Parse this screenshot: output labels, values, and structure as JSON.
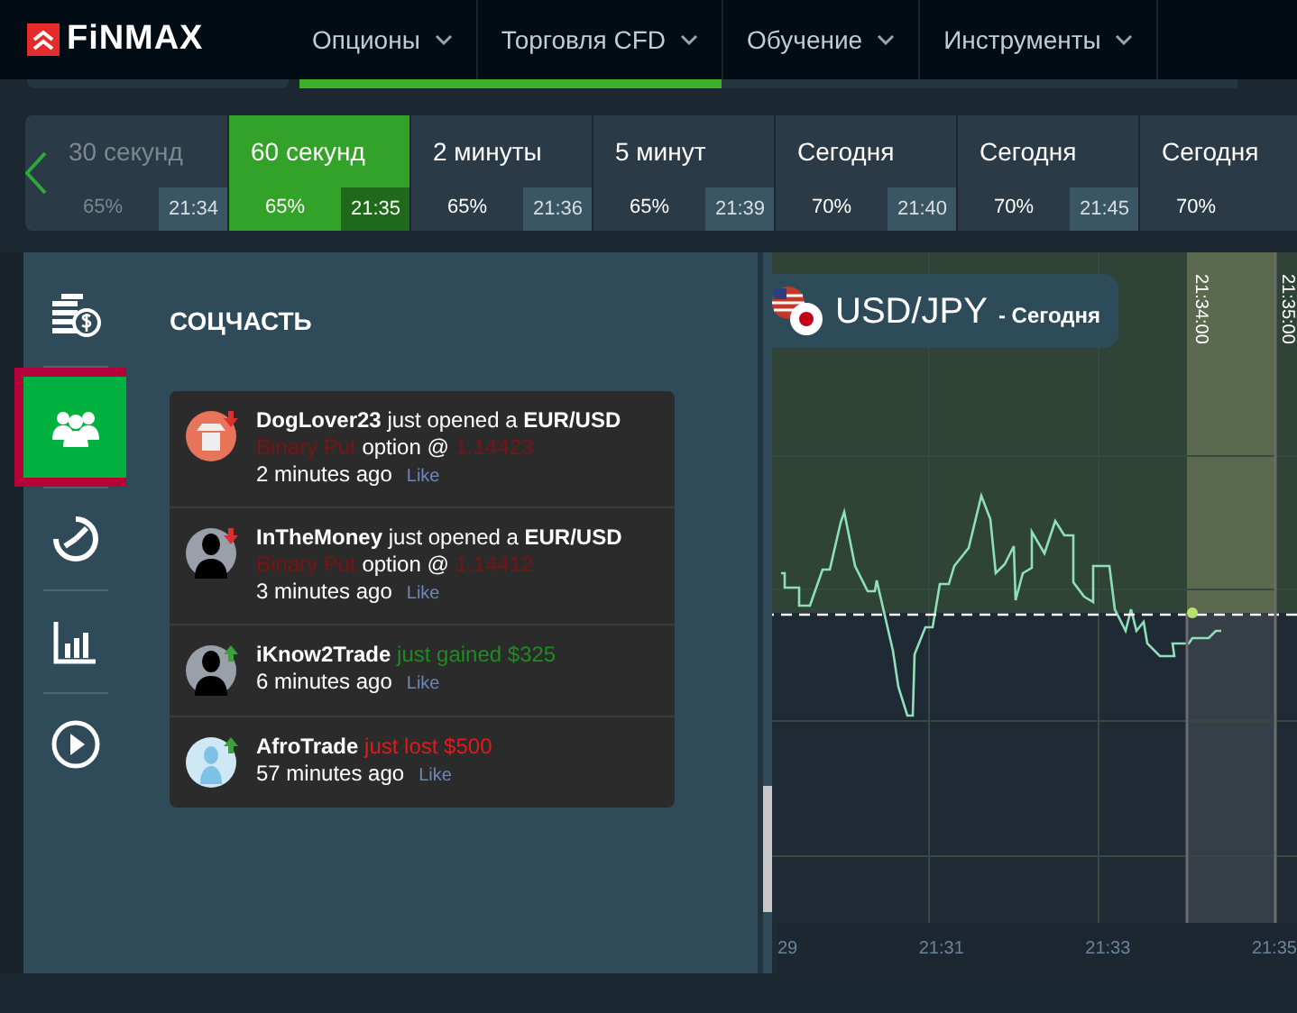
{
  "logo": {
    "text": "FiNMAX"
  },
  "nav": [
    {
      "label": "Опционы"
    },
    {
      "label": "Торговля CFD"
    },
    {
      "label": "Обучение"
    },
    {
      "label": "Инструменты"
    }
  ],
  "progress": {
    "level": 0.45
  },
  "expiry_tiles": [
    {
      "label": "30 секунд",
      "payout": "65%",
      "time": "21:34",
      "selected": false,
      "disabled": true
    },
    {
      "label": "60 секунд",
      "payout": "65%",
      "time": "21:35",
      "selected": true,
      "disabled": false
    },
    {
      "label": "2 минуты",
      "payout": "65%",
      "time": "21:36",
      "selected": false,
      "disabled": false
    },
    {
      "label": "5 минут",
      "payout": "65%",
      "time": "21:39",
      "selected": false,
      "disabled": false
    },
    {
      "label": "Сегодня",
      "payout": "70%",
      "time": "21:40",
      "selected": false,
      "disabled": false
    },
    {
      "label": "Сегодня",
      "payout": "70%",
      "time": "21:45",
      "selected": false,
      "disabled": false
    },
    {
      "label": "Сегодня",
      "payout": "70%",
      "selected": false,
      "disabled": false
    }
  ],
  "sidebar": {
    "items": [
      {
        "kind": "coins",
        "selected": false,
        "highlighted": false
      },
      {
        "kind": "people",
        "selected": true,
        "highlighted": true
      },
      {
        "kind": "timer",
        "selected": false,
        "highlighted": false
      },
      {
        "kind": "chart",
        "selected": false,
        "highlighted": false
      },
      {
        "kind": "play",
        "selected": false,
        "highlighted": false
      }
    ]
  },
  "social": {
    "title": "СОЦЧАСТЬ",
    "feed": [
      {
        "kind": "cowboy",
        "rising": false,
        "parts": [
          {
            "kind": "bold",
            "text": "DogLover23"
          },
          {
            "kind": "plain",
            "text": "just opened a"
          },
          {
            "kind": "bold",
            "text": "EUR/USD"
          },
          {
            "kind": "put",
            "text": "Binary Put"
          },
          {
            "kind": "plain",
            "text": "option @"
          },
          {
            "kind": "put",
            "text": "1.14423"
          }
        ],
        "time": "2 minutes ago",
        "like": "Like"
      },
      {
        "kind": "silhouette",
        "rising": false,
        "parts": [
          {
            "kind": "bold",
            "text": "InTheMoney"
          },
          {
            "kind": "plain",
            "text": "just opened a"
          },
          {
            "kind": "bold",
            "text": "EUR/USD"
          },
          {
            "kind": "put",
            "text": "Binary Put"
          },
          {
            "kind": "plain",
            "text": "option @"
          },
          {
            "kind": "put",
            "text": "1.14412"
          }
        ],
        "time": "3 minutes ago",
        "like": "Like"
      },
      {
        "kind": "silhouette",
        "rising": true,
        "parts": [
          {
            "kind": "bold",
            "text": "iKnow2Trade"
          },
          {
            "kind": "gain",
            "text": "just gained $325"
          }
        ],
        "time": "6 minutes ago",
        "like": "Like"
      },
      {
        "kind": "light",
        "rising": true,
        "parts": [
          {
            "kind": "bold",
            "text": "AfroTrade"
          },
          {
            "kind": "loss",
            "text": "just lost $500"
          }
        ],
        "time": "57 minutes ago",
        "like": "Like"
      }
    ]
  },
  "chart": {
    "pair": "USD/JPY",
    "period": "- Сегодня",
    "markers": [
      "21:34:00",
      "21:35:00"
    ],
    "x_labels": [
      "29",
      "21:31",
      "21:33",
      "21:35"
    ]
  }
}
